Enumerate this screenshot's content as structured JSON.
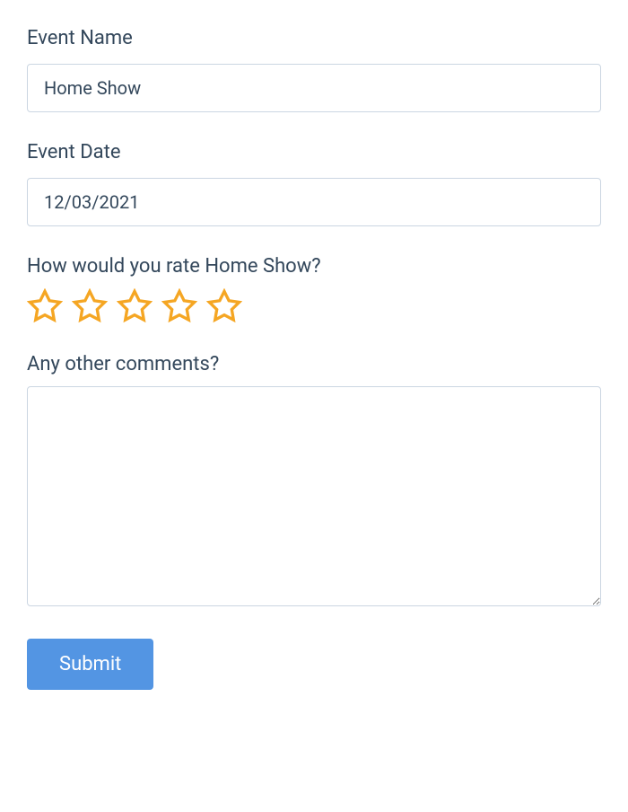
{
  "form": {
    "eventName": {
      "label": "Event Name",
      "value": "Home Show"
    },
    "eventDate": {
      "label": "Event Date",
      "value": "12/03/2021"
    },
    "rating": {
      "label": "How would you rate Home Show?",
      "starCount": 5,
      "starColor": "#f5a623"
    },
    "comments": {
      "label": "Any other comments?",
      "value": ""
    },
    "submit": {
      "label": "Submit"
    }
  }
}
